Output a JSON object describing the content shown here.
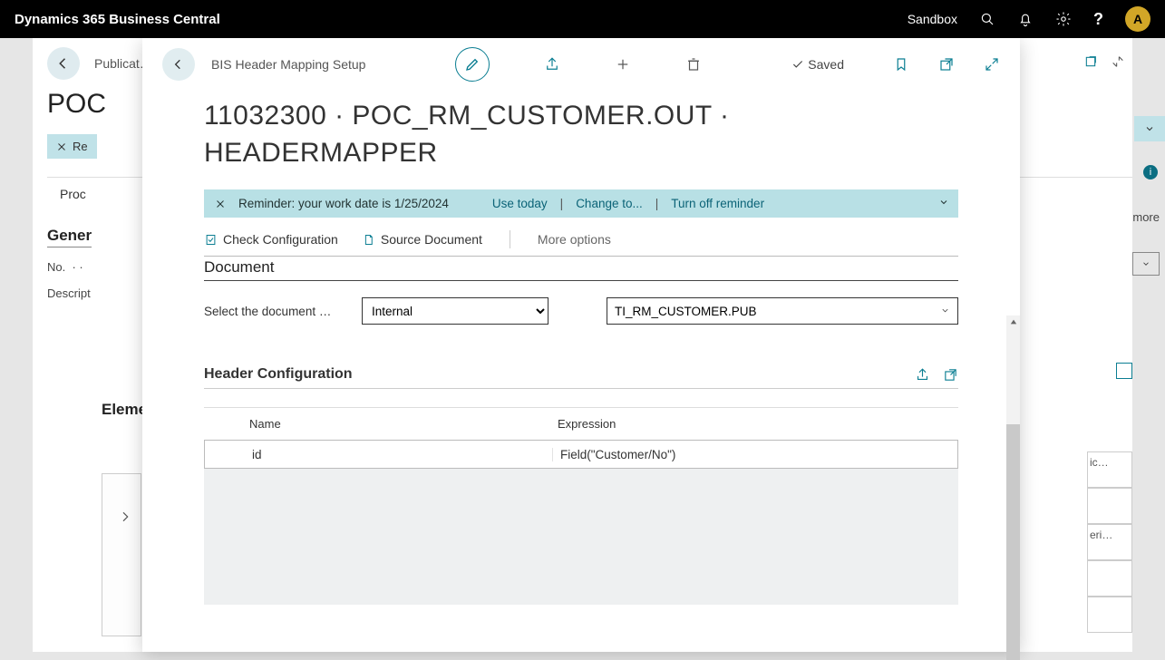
{
  "topbar": {
    "app_title": "Dynamics 365 Business Central",
    "environment": "Sandbox",
    "avatar_letter": "A"
  },
  "background_page": {
    "breadcrumb": "Publicat…",
    "title_fragment": "POC",
    "pill_label": "Re",
    "tab_label": "Proc",
    "section_general": "Gener",
    "field_no": "No.",
    "field_desc": "Descript",
    "section_elements": "Elemen",
    "more_label": "more",
    "fragment1": "ic…",
    "fragment2": "eri…"
  },
  "card": {
    "breadcrumb": "BIS Header Mapping Setup",
    "saved_label": "Saved",
    "title": "11032300 · POC_RM_CUSTOMER.OUT · HEADERMAPPER",
    "reminder": {
      "text": "Reminder: your work date is 1/25/2024",
      "use_today": "Use today",
      "change_to": "Change to...",
      "turn_off": "Turn off reminder"
    },
    "actions": {
      "check_config": "Check Configuration",
      "source_doc": "Source Document",
      "more_options": "More options"
    },
    "document_section": {
      "heading": "Document",
      "label": "Select the document …",
      "select_value": "Internal",
      "lookup_value": "TI_RM_CUSTOMER.PUB"
    },
    "header_config": {
      "heading": "Header Configuration",
      "columns": {
        "name": "Name",
        "expression": "Expression"
      },
      "rows": [
        {
          "name": "id",
          "expression": "Field(\"Customer/No\")"
        }
      ]
    }
  }
}
